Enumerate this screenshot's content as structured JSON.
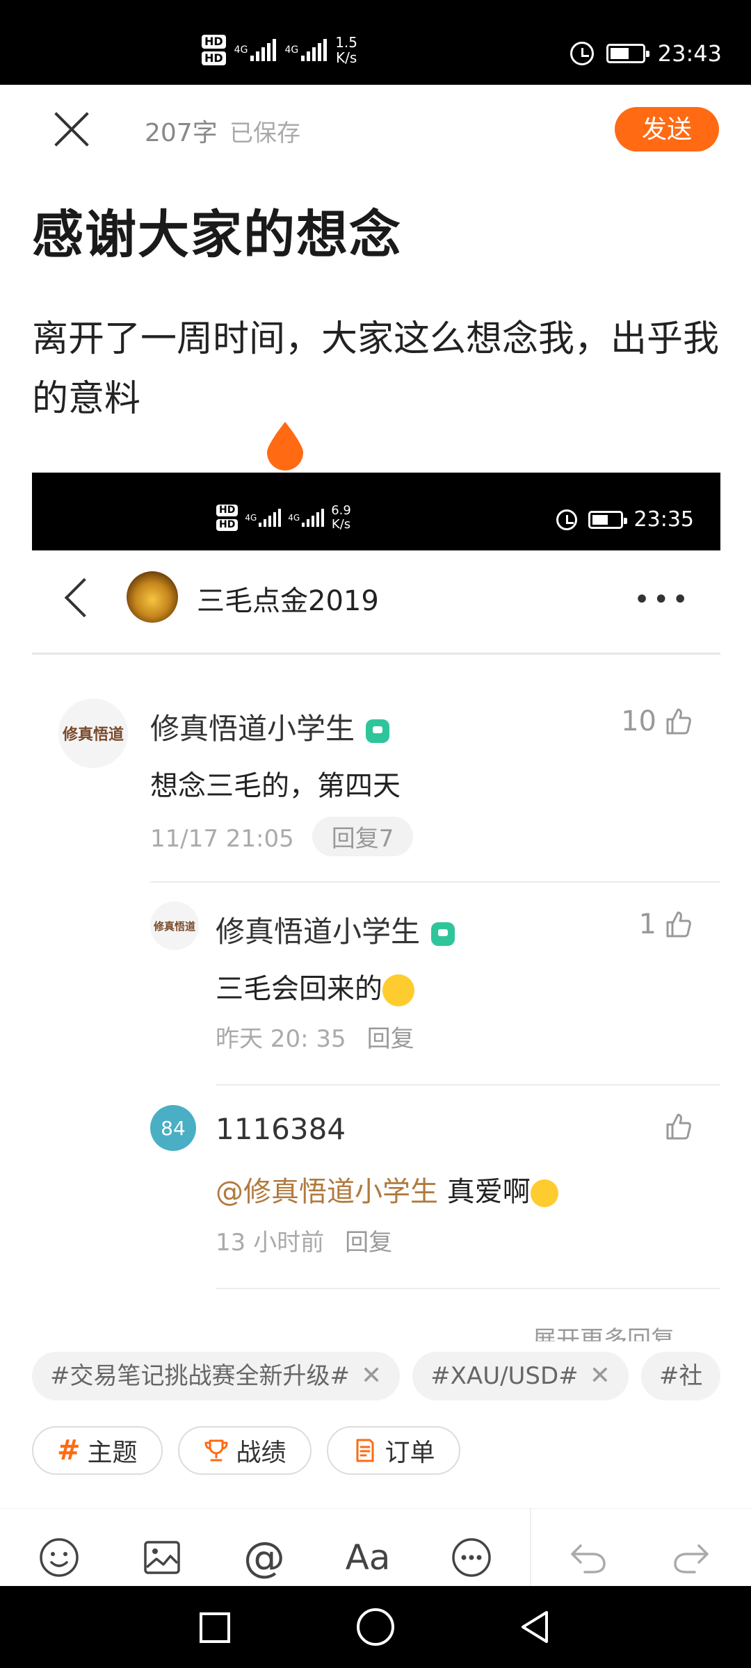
{
  "status_bar": {
    "hd1": "HD",
    "hd2": "HD",
    "net1": "4G",
    "net2": "4G",
    "speed_value": "1.5",
    "speed_unit": "K/s",
    "time": "23:43",
    "battery_level": 0.6
  },
  "editor": {
    "word_count": "207字",
    "saved_status": "已保存",
    "send_label": "发送",
    "title": "感谢大家的想念",
    "body": "离开了一周时间，大家这么想念我，出乎我的意料"
  },
  "embedded": {
    "status_bar": {
      "hd1": "HD",
      "hd2": "HD",
      "net1": "4G",
      "net2": "4G",
      "speed_value": "6.9",
      "speed_unit": "K/s",
      "time": "23:35",
      "battery_level": 0.6
    },
    "header": {
      "name": "三毛点金2019",
      "more": "•••"
    },
    "comments": [
      {
        "avatar_text": "修真悟道",
        "author": "修真悟道小学生",
        "likes": "10",
        "text": "想念三毛的，第四天",
        "time": "11/17 21:05",
        "reply": "回复7"
      },
      {
        "avatar_text": "修真悟道",
        "author": "修真悟道小学生",
        "likes": "1",
        "text": "三毛会回来的",
        "time": "昨天 20: 35",
        "reply": "回复"
      },
      {
        "avatar_text": "84",
        "author": "1116384",
        "likes": "",
        "mention": "@修真悟道小学生",
        "text": "真爱啊",
        "time": "13 小时前",
        "reply": "回复"
      }
    ],
    "expand_more": "展开更多回复"
  },
  "tags": [
    {
      "label": "#交易笔记挑战赛全新升级#"
    },
    {
      "label": "#XAU/USD#"
    },
    {
      "label": "#社"
    }
  ],
  "chips": [
    {
      "icon": "#",
      "label": "主题"
    },
    {
      "icon": "trophy-icon",
      "label": "战绩"
    },
    {
      "icon": "order-icon",
      "label": "订单"
    }
  ],
  "toolbar": [
    "emoji-icon",
    "image-icon",
    "at-icon",
    "font-icon",
    "more-icon",
    "undo-icon",
    "redo-icon"
  ],
  "colors": {
    "accent": "#ff6a13",
    "badge": "#2fc59a",
    "mention": "#b07a3e"
  }
}
